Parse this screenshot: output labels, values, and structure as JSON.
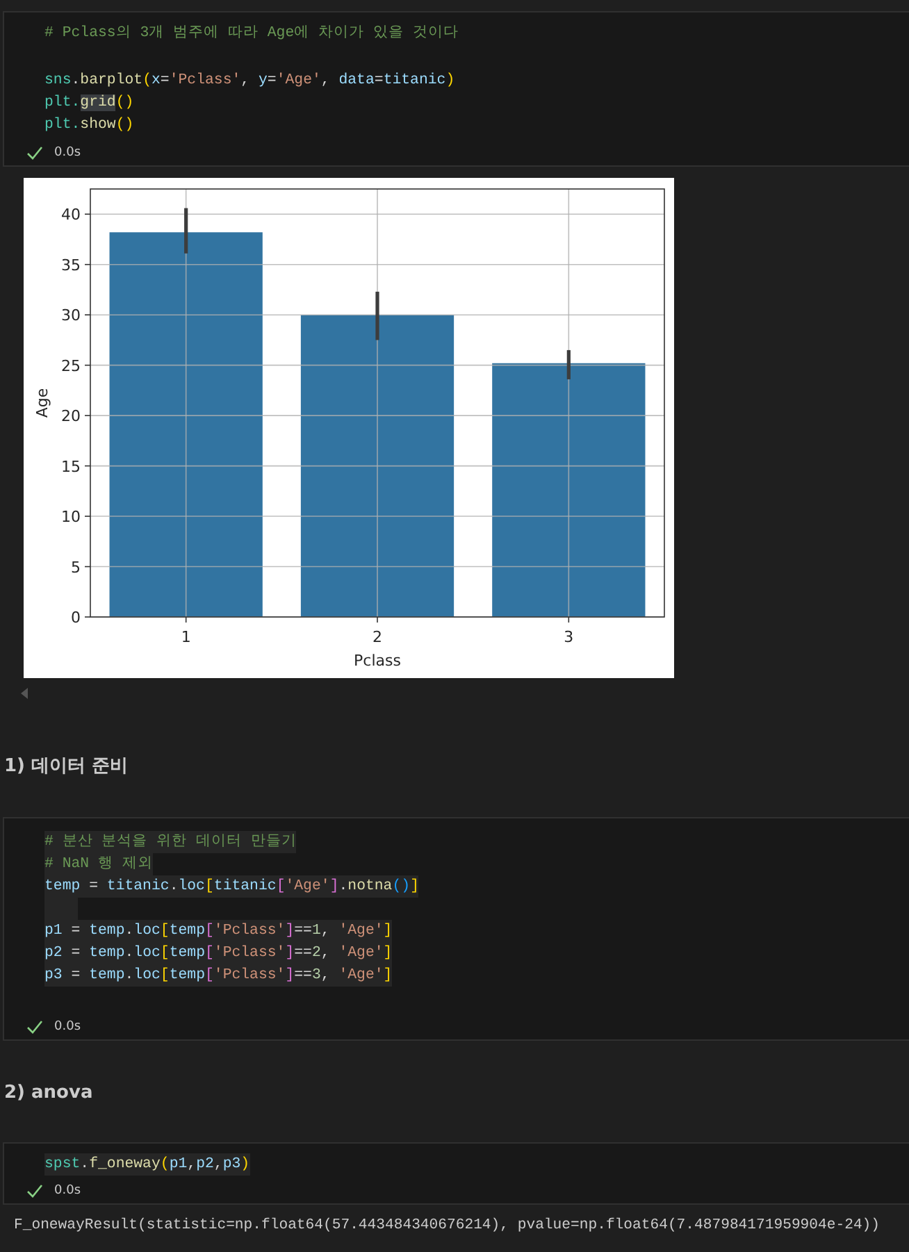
{
  "cells": [
    {
      "kind": "code",
      "lines": [
        {
          "kind": "code",
          "selected": false,
          "tokens": [
            {
              "kind": "comment",
              "text": "# Pclass의 3개 범주에 따라 Age에 차이가 있을 것이다"
            }
          ]
        },
        {
          "kind": "blank"
        },
        {
          "kind": "code",
          "selected": false,
          "tokens": [
            {
              "kind": "module",
              "text": "sns"
            },
            {
              "kind": "op",
              "text": "."
            },
            {
              "kind": "func",
              "text": "barplot"
            },
            {
              "kind": "br1",
              "text": "("
            },
            {
              "kind": "var",
              "text": "x"
            },
            {
              "kind": "op",
              "text": "="
            },
            {
              "kind": "str",
              "text": "'Pclass'"
            },
            {
              "kind": "op",
              "text": ", "
            },
            {
              "kind": "var",
              "text": "y"
            },
            {
              "kind": "op",
              "text": "="
            },
            {
              "kind": "str",
              "text": "'Age'"
            },
            {
              "kind": "op",
              "text": ", "
            },
            {
              "kind": "var",
              "text": "data"
            },
            {
              "kind": "op",
              "text": "="
            },
            {
              "kind": "var",
              "text": "titanic"
            },
            {
              "kind": "br1",
              "text": ")"
            }
          ]
        },
        {
          "kind": "code",
          "selected": false,
          "tokens": [
            {
              "kind": "module",
              "text": "plt."
            },
            {
              "kind": "match",
              "text": "grid"
            },
            {
              "kind": "br1",
              "text": "()"
            }
          ]
        },
        {
          "kind": "code",
          "selected": false,
          "tokens": [
            {
              "kind": "module",
              "text": "plt."
            },
            {
              "kind": "func",
              "text": "show"
            },
            {
              "kind": "br1",
              "text": "()"
            }
          ]
        }
      ],
      "status": {
        "success": true,
        "time": "0.0s"
      },
      "output": {
        "kind": "chart",
        "chart_data": {
          "type": "bar",
          "xlabel": "Pclass",
          "ylabel": "Age",
          "categories": [
            "1",
            "2",
            "3"
          ],
          "values": [
            38.2,
            30.0,
            25.2
          ],
          "ylim": [
            0,
            42.5
          ],
          "yticks": [
            0,
            5,
            10,
            15,
            20,
            25,
            30,
            35,
            40
          ],
          "grid": true
        }
      }
    },
    {
      "kind": "markdown",
      "heading": "1) 데이터 준비"
    },
    {
      "kind": "code",
      "lines": [
        {
          "kind": "code",
          "selected": true,
          "tokens": [
            {
              "kind": "comment",
              "text": "# 분산 분석을 위한 데이터 만들기"
            }
          ]
        },
        {
          "kind": "code",
          "selected": true,
          "tokens": [
            {
              "kind": "comment",
              "text": "# NaN 행 제외"
            }
          ]
        },
        {
          "kind": "code",
          "selected": true,
          "tokens": [
            {
              "kind": "var",
              "text": "temp"
            },
            {
              "kind": "op",
              "text": " = "
            },
            {
              "kind": "var",
              "text": "titanic"
            },
            {
              "kind": "op",
              "text": "."
            },
            {
              "kind": "var",
              "text": "loc"
            },
            {
              "kind": "br1",
              "text": "["
            },
            {
              "kind": "var",
              "text": "titanic"
            },
            {
              "kind": "br2",
              "text": "["
            },
            {
              "kind": "str",
              "text": "'Age'"
            },
            {
              "kind": "br2",
              "text": "]"
            },
            {
              "kind": "op",
              "text": "."
            },
            {
              "kind": "func",
              "text": "notna"
            },
            {
              "kind": "br3",
              "text": "()"
            },
            {
              "kind": "br1",
              "text": "]"
            }
          ]
        },
        {
          "kind": "blank",
          "selected": true
        },
        {
          "kind": "code",
          "selected": true,
          "tokens": [
            {
              "kind": "var",
              "text": "p1"
            },
            {
              "kind": "op",
              "text": " = "
            },
            {
              "kind": "var",
              "text": "temp"
            },
            {
              "kind": "op",
              "text": "."
            },
            {
              "kind": "var",
              "text": "loc"
            },
            {
              "kind": "br1",
              "text": "["
            },
            {
              "kind": "var",
              "text": "temp"
            },
            {
              "kind": "br2",
              "text": "["
            },
            {
              "kind": "str",
              "text": "'Pclass'"
            },
            {
              "kind": "br2",
              "text": "]"
            },
            {
              "kind": "op",
              "text": "=="
            },
            {
              "kind": "num",
              "text": "1"
            },
            {
              "kind": "op",
              "text": ", "
            },
            {
              "kind": "str",
              "text": "'Age'"
            },
            {
              "kind": "br1",
              "text": "]"
            }
          ]
        },
        {
          "kind": "code",
          "selected": true,
          "tokens": [
            {
              "kind": "var",
              "text": "p2"
            },
            {
              "kind": "op",
              "text": " = "
            },
            {
              "kind": "var",
              "text": "temp"
            },
            {
              "kind": "op",
              "text": "."
            },
            {
              "kind": "var",
              "text": "loc"
            },
            {
              "kind": "br1",
              "text": "["
            },
            {
              "kind": "var",
              "text": "temp"
            },
            {
              "kind": "br2",
              "text": "["
            },
            {
              "kind": "str",
              "text": "'Pclass'"
            },
            {
              "kind": "br2",
              "text": "]"
            },
            {
              "kind": "op",
              "text": "=="
            },
            {
              "kind": "num",
              "text": "2"
            },
            {
              "kind": "op",
              "text": ", "
            },
            {
              "kind": "str",
              "text": "'Age'"
            },
            {
              "kind": "br1",
              "text": "]"
            }
          ]
        },
        {
          "kind": "code",
          "selected": true,
          "tokens": [
            {
              "kind": "var",
              "text": "p3"
            },
            {
              "kind": "op",
              "text": " = "
            },
            {
              "kind": "var",
              "text": "temp"
            },
            {
              "kind": "op",
              "text": "."
            },
            {
              "kind": "var",
              "text": "loc"
            },
            {
              "kind": "br1",
              "text": "["
            },
            {
              "kind": "var",
              "text": "temp"
            },
            {
              "kind": "br2",
              "text": "["
            },
            {
              "kind": "str",
              "text": "'Pclass'"
            },
            {
              "kind": "br2",
              "text": "]"
            },
            {
              "kind": "op",
              "text": "=="
            },
            {
              "kind": "num",
              "text": "3"
            },
            {
              "kind": "op",
              "text": ", "
            },
            {
              "kind": "str",
              "text": "'Age'"
            },
            {
              "kind": "br1",
              "text": "]"
            }
          ]
        }
      ],
      "status": {
        "success": true,
        "time": "0.0s"
      }
    },
    {
      "kind": "markdown",
      "heading": "2) anova"
    },
    {
      "kind": "code",
      "lines": [
        {
          "kind": "code",
          "selected": true,
          "tokens": [
            {
              "kind": "module",
              "text": "spst"
            },
            {
              "kind": "op",
              "text": "."
            },
            {
              "kind": "func",
              "text": "f_oneway"
            },
            {
              "kind": "br1",
              "text": "("
            },
            {
              "kind": "var",
              "text": "p1"
            },
            {
              "kind": "op",
              "text": ","
            },
            {
              "kind": "var",
              "text": "p2"
            },
            {
              "kind": "op",
              "text": ","
            },
            {
              "kind": "var",
              "text": "p3"
            },
            {
              "kind": "br1",
              "text": ")"
            }
          ]
        }
      ],
      "status": {
        "success": true,
        "time": "0.0s"
      },
      "output": {
        "kind": "text",
        "text": "F_onewayResult(statistic=np.float64(57.443484340676214), pvalue=np.float64(7.487984171959904e-24))"
      }
    }
  ]
}
